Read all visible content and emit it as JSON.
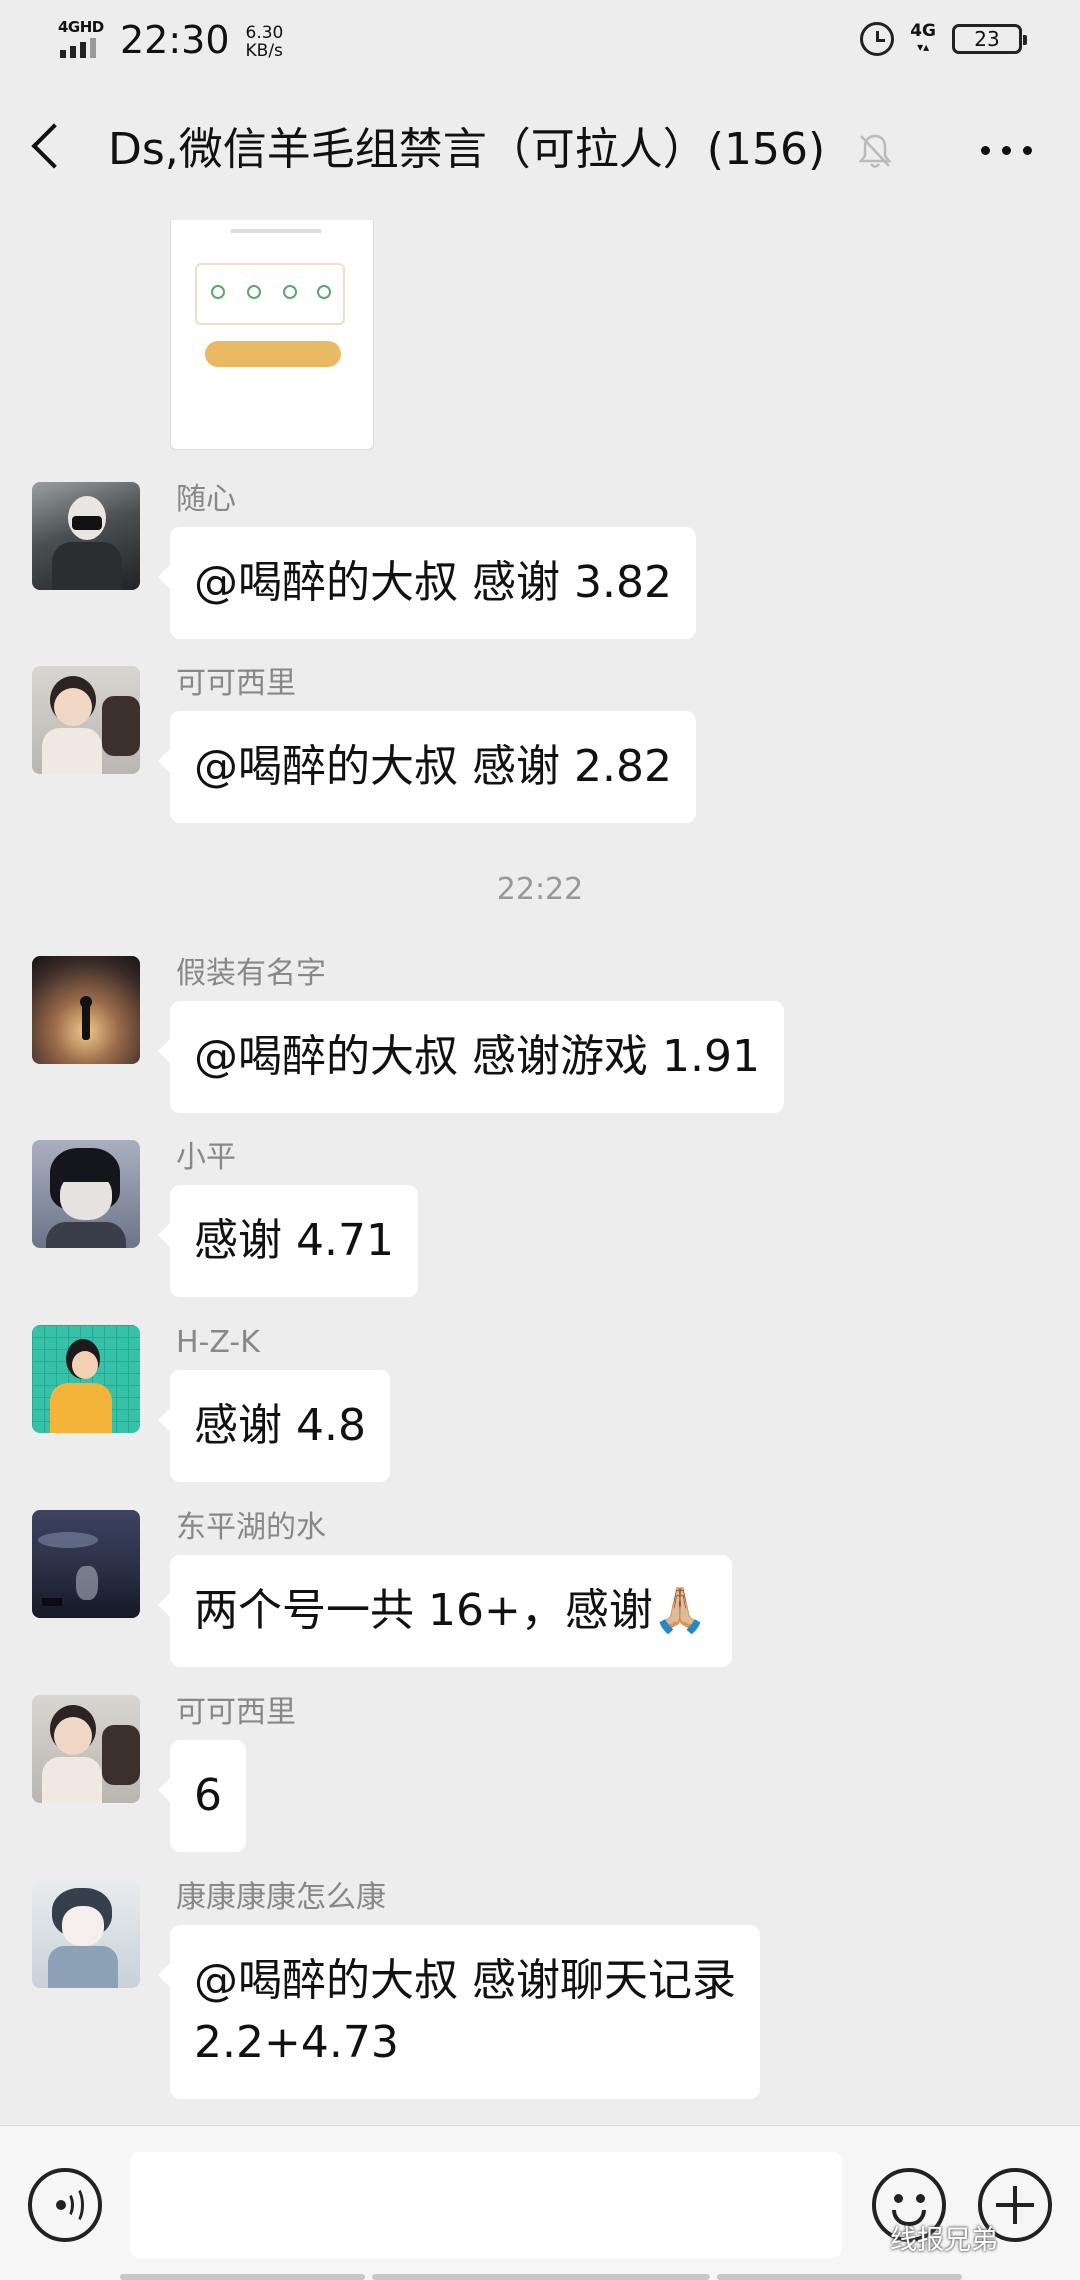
{
  "status_bar": {
    "network_label": "4GHD",
    "time": "22:30",
    "speed_value": "6.30",
    "speed_unit": "KB/s",
    "right_network": "4G",
    "battery": "23",
    "icons": [
      "signal-icon",
      "alarm-icon",
      "battery-icon"
    ]
  },
  "header": {
    "title": "Ds,微信羊毛组禁言（可拉人）(156)",
    "icons": [
      "back-arrow-icon",
      "mute-bell-icon",
      "more-icon"
    ]
  },
  "messages": [
    {
      "sender": "随心",
      "text": "@喝醉的大叔  感谢 3.82"
    },
    {
      "sender": "可可西里",
      "text": "@喝醉的大叔  感谢 2.82"
    },
    {
      "sender": "假装有名字",
      "text": "@喝醉的大叔  感谢游戏 1.91"
    },
    {
      "sender": "小平",
      "text": "感谢 4.71"
    },
    {
      "sender": "H-Z-K",
      "text": "感谢 4.8"
    },
    {
      "sender": "东平湖的水",
      "text": "两个号一共 16+，感谢🙏🏼"
    },
    {
      "sender": "可可西里",
      "text": "6"
    },
    {
      "sender": "康康康康怎么康",
      "text": "@喝醉的大叔  感谢聊天记录\n2.2+4.73"
    }
  ],
  "time_divider": "22:22",
  "input_bar": {
    "placeholder": "",
    "icons": [
      "voice-icon",
      "emoji-icon",
      "plus-icon"
    ]
  },
  "watermark": "线报兄弟"
}
